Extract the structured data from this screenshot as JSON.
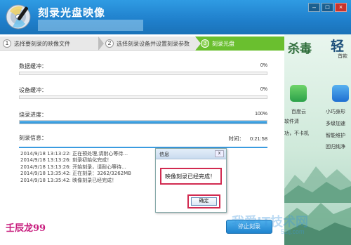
{
  "window": {
    "title": "刻录光盘映像",
    "icon": "disc-burn-icon",
    "controls": [
      "minimize",
      "maximize",
      "close"
    ]
  },
  "steps": [
    {
      "num": "1",
      "label": "选择要刻录的映像文件"
    },
    {
      "num": "2",
      "label": "选择刻录设备并设置刻录参数"
    },
    {
      "num": "3",
      "label": "刻录光盘"
    }
  ],
  "progress": [
    {
      "label": "数据缓冲：",
      "value_text": "0%",
      "fraction": 0
    },
    {
      "label": "设备缓冲：",
      "value_text": "0%",
      "fraction": 0
    },
    {
      "label": "烧录进度：",
      "value_text": "100%",
      "fraction": 1
    }
  ],
  "info": {
    "label": "刻录信息：",
    "time_label": "时间：",
    "time_value": "0:21:58"
  },
  "log": [
    "2014/9/18 13:13:22:  正在预处理,请耐心等待...",
    "2014/9/18 13:13:26:  刻录初始化完成！",
    "2014/9/18 13:13:26:  开始刻录，请耐心等待...",
    "2014/9/18 13:35:42:  正在刻录：3262/3262MB",
    "2014/9/18 13:35:42:    映像刻录已经完成！"
  ],
  "dialog": {
    "title": "信息",
    "message": "映像刻录已经完成！",
    "ok_label": "确定",
    "close_label": "x"
  },
  "stop_button": "停止刻录",
  "brand_text": "壬辰龙99",
  "ad": {
    "title1": "杀毒",
    "title2": "轻",
    "sub2": "首款",
    "line1": "百度云",
    "line2": "软件清",
    "line3": "功，不卡机",
    "line4": "小巧身形",
    "line5": "多级加速",
    "line6": "智能维护",
    "line7": "回归纯净"
  },
  "watermark": "我爱IT技术网",
  "watermark_small": "52ij.com",
  "colors": {
    "accent": "#1f84cf",
    "step_active": "#6abf2f",
    "highlight": "#d12a50"
  }
}
